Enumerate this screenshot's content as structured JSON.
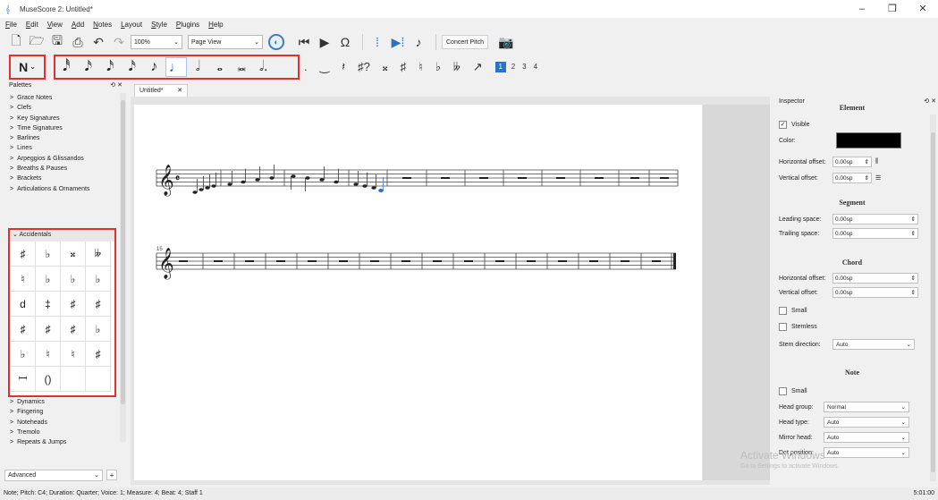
{
  "window": {
    "title": "MuseScore 2: Untitled*",
    "controls": [
      "–",
      "❐",
      "✕"
    ]
  },
  "menu": [
    "File",
    "Edit",
    "View",
    "Add",
    "Notes",
    "Layout",
    "Style",
    "Plugins",
    "Help"
  ],
  "toolbar": {
    "zoom": "100%",
    "view_mode": "Page View",
    "concert_pitch": "Concert Pitch"
  },
  "note_input": {
    "mode_label": "N",
    "durations": [
      "𝅘𝅥𝅰",
      "𝅘𝅥𝅯",
      "𝅘𝅥𝅯",
      "𝅘𝅥𝅯",
      "♪",
      "♩",
      "𝅗𝅥",
      "𝅝",
      "𝅜",
      "𝅗𝅥."
    ],
    "active_index": 5,
    "extra_tools": [
      ".",
      "‿",
      "𝄽",
      "♯?",
      "𝄪",
      "♯",
      "♮",
      "♭",
      "𝄫",
      "↗"
    ],
    "voices": [
      "1",
      "2",
      "3",
      "4"
    ]
  },
  "palettes": {
    "title": "Palettes",
    "items_top": [
      "Grace Notes",
      "Clefs",
      "Key Signatures",
      "Time Signatures",
      "Barlines",
      "Lines",
      "Arpeggios & Glissandos",
      "Breaths & Pauses",
      "Brackets",
      "Articulations & Ornaments"
    ],
    "accidentals_title": "Accidentals",
    "accidentals": [
      "♯",
      "♭",
      "𝄪",
      "𝄫",
      "♮",
      "♭",
      "♭",
      "♭",
      "d",
      "‡",
      "♯",
      "♯",
      "♯",
      "♯",
      "♯",
      "♭",
      "♭",
      "♮",
      "♮",
      "♯",
      "𝄩",
      "()",
      "",
      ""
    ],
    "items_bottom": [
      "Dynamics",
      "Fingering",
      "Noteheads",
      "Tremolo",
      "Repeats & Jumps"
    ],
    "mode": "Advanced",
    "add": "+"
  },
  "score": {
    "tab": "Untitled*",
    "tab_close": "✕",
    "measure_number": "15"
  },
  "inspector": {
    "title": "Inspector",
    "element": {
      "title": "Element",
      "visible_label": "Visible",
      "color_label": "Color:",
      "hoffset_label": "Horizontal offset:",
      "hoffset": "0.00sp",
      "voffset_label": "Vertical offset:",
      "voffset": "0.00sp"
    },
    "segment": {
      "title": "Segment",
      "leading_label": "Leading space:",
      "leading": "0.00sp",
      "trailing_label": "Trailing space:",
      "trailing": "0.00sp"
    },
    "chord": {
      "title": "Chord",
      "hoffset_label": "Horizontal offset:",
      "hoffset": "0.00sp",
      "voffset_label": "Vertical offset:",
      "voffset": "0.00sp",
      "small_label": "Small",
      "stemless_label": "Stemless",
      "stem_dir_label": "Stem direction:",
      "stem_dir": "Auto"
    },
    "note": {
      "title": "Note",
      "small_label": "Small",
      "head_group_label": "Head group:",
      "head_group": "Normal",
      "head_type_label": "Head type:",
      "head_type": "Auto",
      "mirror_label": "Mirror head:",
      "mirror": "Auto",
      "dot_label": "Dot position:",
      "dot": "Auto"
    }
  },
  "watermark": {
    "line1": "Activate Windows",
    "line2": "Go to Settings to activate Windows."
  },
  "status": {
    "text": "Note; Pitch: C4; Duration: Quarter; Voice: 1; Measure: 4; Beat: 4; Staff 1",
    "time": "5:01:00"
  }
}
